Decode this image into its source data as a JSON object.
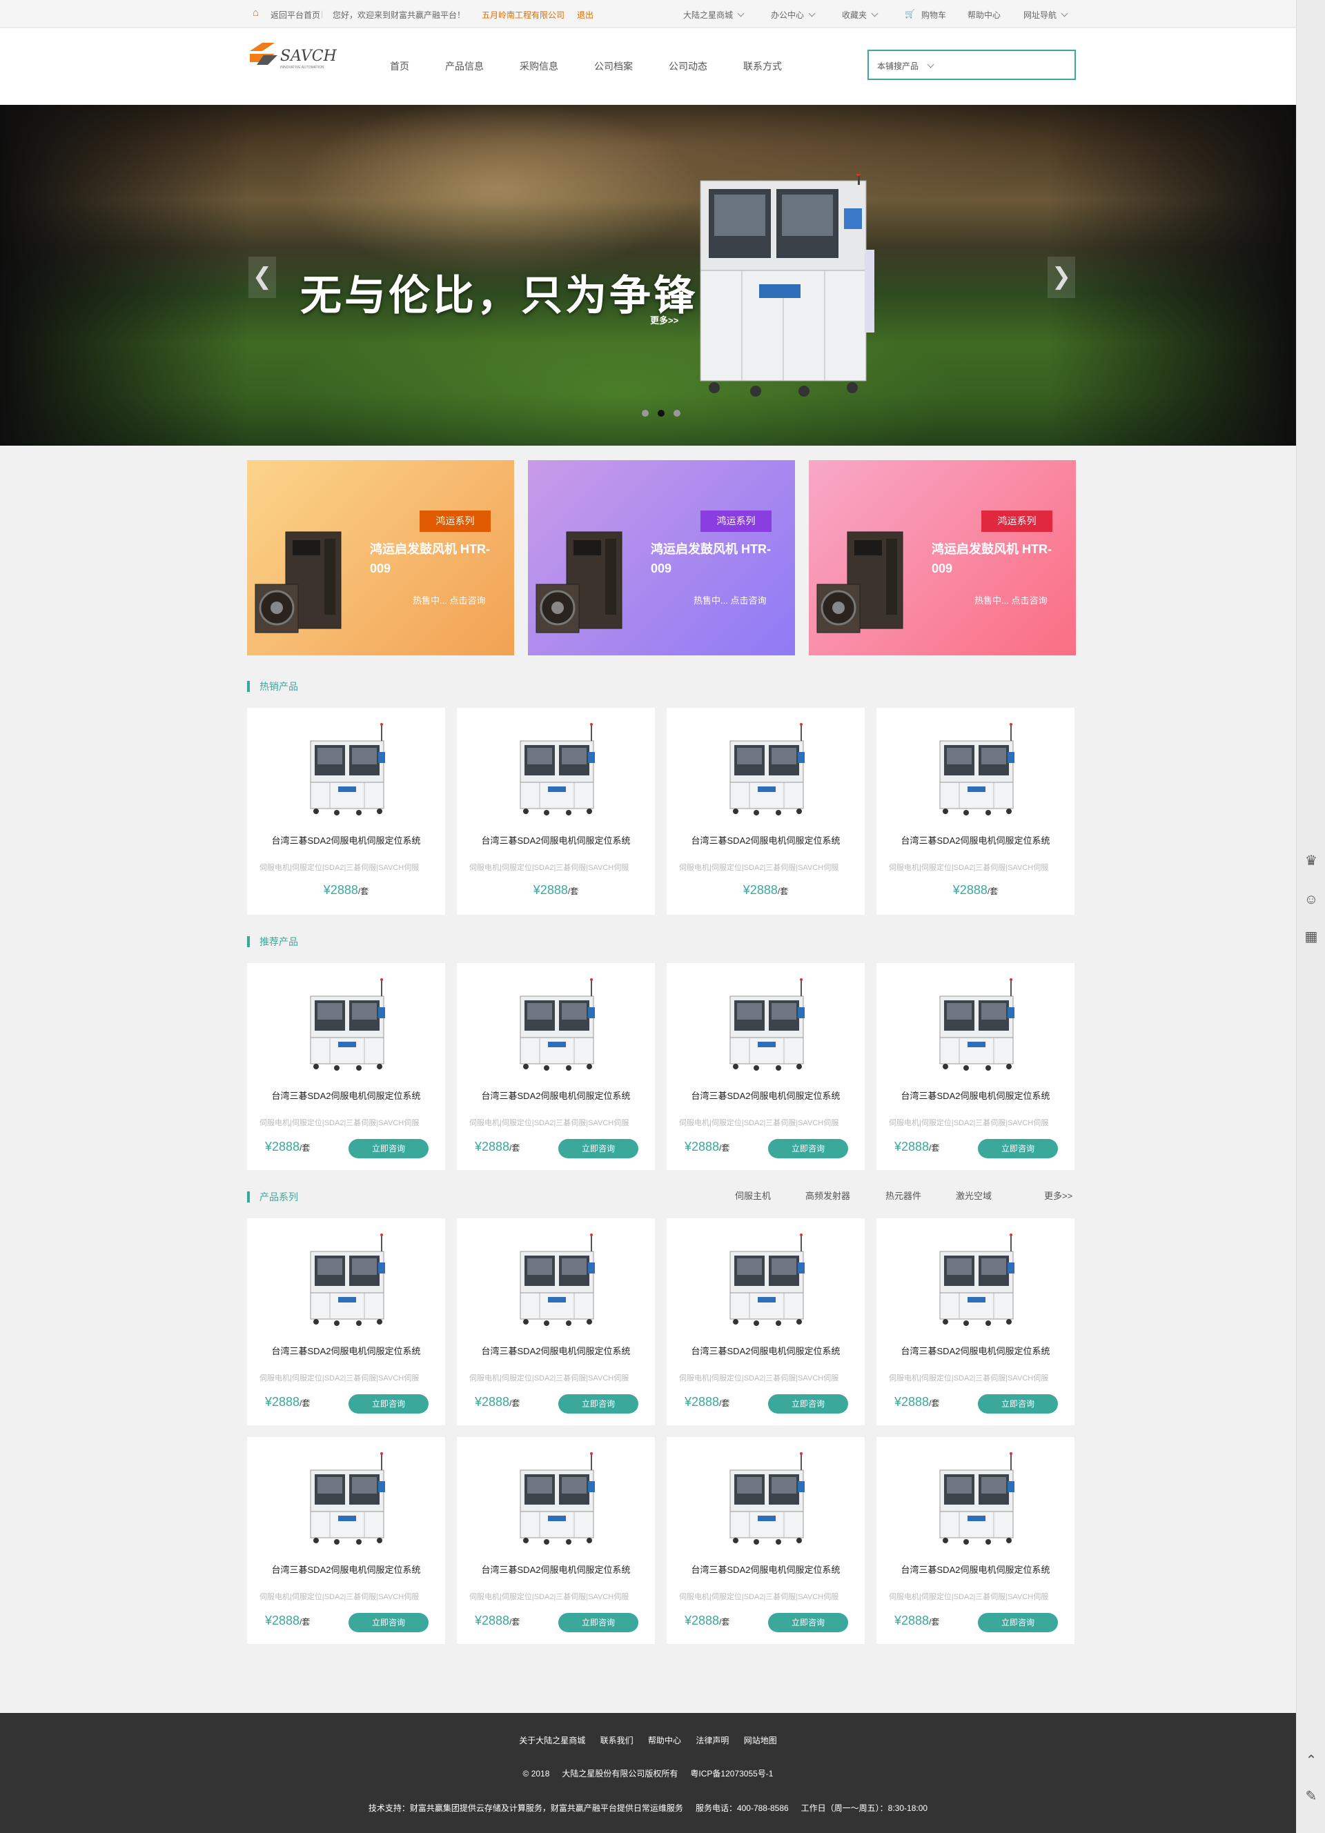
{
  "topbar": {
    "home_link": "返回平台首页",
    "welcome": "您好，欢迎来到财富共赢产融平台！",
    "company": "五月岭南工程有限公司",
    "logout": "退出",
    "menus": [
      "大陆之星商城",
      "办公中心",
      "收藏夹",
      "购物车",
      "帮助中心",
      "网址导航"
    ]
  },
  "header": {
    "logo_text": "SAVCH",
    "logo_sub": "INNOVATIVE AUTOMATION",
    "nav": [
      "首页",
      "产品信息",
      "采购信息",
      "公司档案",
      "公司动态",
      "联系方式"
    ],
    "search_scope": "本铺搜产品",
    "search_placeholder": ""
  },
  "hero": {
    "title": "无与伦比，只为争锋！",
    "more": "更多>>",
    "prev": "❮",
    "next": "❯",
    "slide_count": 3,
    "active_slide": 2
  },
  "promos": [
    {
      "tag": "鸿运系列",
      "name": "鸿运启发鼓风机 HTR-009",
      "cta": "热售中... 点击咨询",
      "bg_from": "#fbd48a",
      "bg_to": "#f2a154",
      "tag_color": "#e05a00"
    },
    {
      "tag": "鸿运系列",
      "name": "鸿运启发鼓风机 HTR-009",
      "cta": "热售中... 点击咨询",
      "bg_from": "#c89be8",
      "bg_to": "#8f7af5",
      "tag_color": "#8a3de0"
    },
    {
      "tag": "鸿运系列",
      "name": "鸿运启发鼓风机 HTR-009",
      "cta": "热售中... 点击咨询",
      "bg_from": "#f8a8c8",
      "bg_to": "#fa6e82",
      "tag_color": "#e0283f"
    }
  ],
  "sections": {
    "hot": "热销产品",
    "recommend": "推荐产品",
    "series": "产品系列",
    "series_tabs": [
      "伺服主机",
      "高频发射器",
      "热元器件",
      "激光空域"
    ],
    "series_more": "更多>>"
  },
  "product": {
    "title": "台湾三碁SDA2伺服电机伺服定位系统",
    "desc": "伺服电机|伺服定位|SDA2|三碁伺服|SAVCH伺服",
    "price": "¥2888",
    "unit": "/套",
    "ask": "立即咨询"
  },
  "footer": {
    "links": [
      "关于大陆之星商城",
      "联系我们",
      "帮助中心",
      "法律声明",
      "网站地图"
    ],
    "copyright": "© 2018",
    "company": "大陆之星股份有限公司版权所有",
    "icp": "粤ICP备12073055号-1",
    "support": "技术支持：财富共赢集团提供云存储及计算服务，财富共赢产融平台提供日常运维服务",
    "phone": "服务电话：400-788-8586",
    "hours": "工作日（周一～周五）：8:30-18:00"
  },
  "colors": {
    "accent": "#3aa99c",
    "topbar_orange": "#e66b00",
    "footer": "#333333"
  }
}
